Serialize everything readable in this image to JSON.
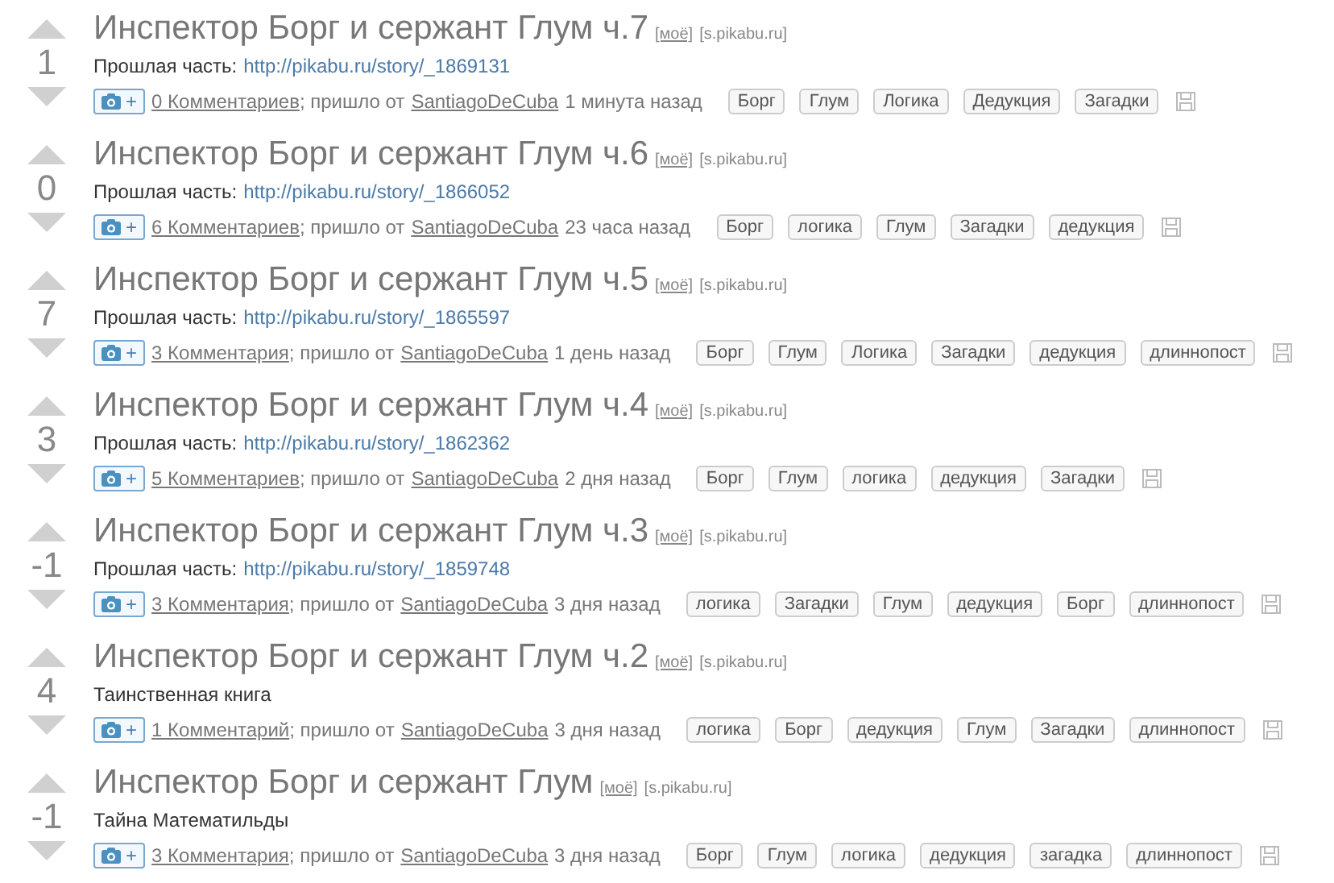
{
  "posts": [
    {
      "add": "+",
      "score": "1",
      "title": "Инспектор Борг и сержант Глум ч.7",
      "mine": "[моё]",
      "source": "[s.pikabu.ru]",
      "prefix": "Прошлая часть:",
      "link": "http://pikabu.ru/story/_1869131",
      "comments": "0 Комментариев",
      "from": "; пришло от",
      "author": "SantiagoDeCuba",
      "time": "1 минута назад",
      "tags": [
        "Борг",
        "Глум",
        "Логика",
        "Дедукция",
        "Загадки"
      ]
    },
    {
      "add": "+",
      "score": "0",
      "title": "Инспектор Борг и сержант Глум ч.6",
      "mine": "[моё]",
      "source": "[s.pikabu.ru]",
      "prefix": "Прошлая часть:",
      "link": "http://pikabu.ru/story/_1866052",
      "comments": "6 Комментариев",
      "from": "; пришло от",
      "author": "SantiagoDeCuba",
      "time": "23 часа назад",
      "tags": [
        "Борг",
        "логика",
        "Глум",
        "Загадки",
        "дедукция"
      ]
    },
    {
      "add": "+",
      "score": "7",
      "title": "Инспектор Борг и сержант Глум ч.5",
      "mine": "[моё]",
      "source": "[s.pikabu.ru]",
      "prefix": "Прошлая часть:",
      "link": "http://pikabu.ru/story/_1865597",
      "comments": "3 Комментария",
      "from": "; пришло от",
      "author": "SantiagoDeCuba",
      "time": "1 день назад",
      "tags": [
        "Борг",
        "Глум",
        "Логика",
        "Загадки",
        "дедукция",
        "длиннопост"
      ]
    },
    {
      "add": "+",
      "score": "3",
      "title": "Инспектор Борг и сержант Глум ч.4",
      "mine": "[моё]",
      "source": "[s.pikabu.ru]",
      "prefix": "Прошлая часть:",
      "link": "http://pikabu.ru/story/_1862362",
      "comments": "5 Комментариев",
      "from": "; пришло от",
      "author": "SantiagoDeCuba",
      "time": "2 дня назад",
      "tags": [
        "Борг",
        "Глум",
        "логика",
        "дедукция",
        "Загадки"
      ]
    },
    {
      "add": "+",
      "score": "-1",
      "title": "Инспектор Борг и сержант Глум ч.3",
      "mine": "[моё]",
      "source": "[s.pikabu.ru]",
      "prefix": "Прошлая часть:",
      "link": "http://pikabu.ru/story/_1859748",
      "comments": "3 Комментария",
      "from": "; пришло от",
      "author": "SantiagoDeCuba",
      "time": "3 дня назад",
      "tags": [
        "логика",
        "Загадки",
        "Глум",
        "дедукция",
        "Борг",
        "длиннопост"
      ]
    },
    {
      "add": "+",
      "score": "4",
      "title": "Инспектор Борг и сержант Глум ч.2",
      "mine": "[моё]",
      "source": "[s.pikabu.ru]",
      "text": "Таинственная книга",
      "comments": "1 Комментарий",
      "from": "; пришло от",
      "author": "SantiagoDeCuba",
      "time": "3 дня назад",
      "tags": [
        "логика",
        "Борг",
        "дедукция",
        "Глум",
        "Загадки",
        "длиннопост"
      ]
    },
    {
      "add": "+",
      "score": "-1",
      "title": "Инспектор Борг и сержант Глум",
      "mine": "[моё]",
      "source": "[s.pikabu.ru]",
      "text": "Тайна Математильды",
      "comments": "3 Комментария",
      "from": "; пришло от",
      "author": "SantiagoDeCuba",
      "time": "3 дня назад",
      "tags": [
        "Борг",
        "Глум",
        "логика",
        "дедукция",
        "загадка",
        "длиннопост"
      ]
    }
  ]
}
